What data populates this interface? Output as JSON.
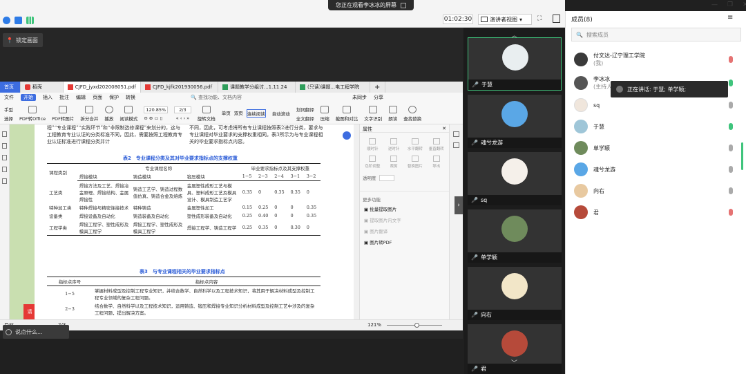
{
  "banner": {
    "text": "您正在观看李冰冰的屏幕"
  },
  "toolbar": {
    "timer": "01:02:30",
    "presenter_view": "演讲者视图"
  },
  "stage": {
    "lock_label": "锁定画面",
    "say_placeholder": "说点什么..."
  },
  "wps": {
    "tabs": [
      {
        "label": "首页"
      },
      {
        "label": "稻壳"
      },
      {
        "label": "CJFD_jyxd202008051.pdf"
      },
      {
        "label": "CJFD_kjfk201930056.pdf"
      },
      {
        "label": "课题教学分组讨...1.11.24"
      },
      {
        "label": "(只读)课题...电工程学院"
      }
    ],
    "menus": [
      "文件",
      "开始",
      "插入",
      "批注",
      "编辑",
      "页面",
      "保护",
      "转换"
    ],
    "active_menu": "开始",
    "tools": [
      "手型",
      "选择",
      "PDF转Office",
      "PDF转图片",
      "拆分合并",
      "播放",
      "阅读模式",
      "旋转文档",
      "单页",
      "双页",
      "连续阅读",
      "自动滚动",
      "划词翻译",
      "全文翻译",
      "压缩",
      "截图和对比",
      "文字识别",
      "朗读",
      "查找替换"
    ],
    "zoom": "120.85%",
    "page_indicator": "2/3",
    "search_placeholder": "查找功能、文档内容",
    "cloud": "未同步",
    "share": "分享",
    "doc": {
      "para1": "程”“专业课程”“实践环节”和“非限制选修课程”来划分的，这与工程教育专业认证的分类标准不同，因此，需要按照工程教育专业认证标准进行课程分类并计",
      "para2": "不同，因此，可考虑将所有专业课程按照表2进行分类，要求与专业课程对毕业要求的支撑权重相同。表3所示为与专业课程相关的毕业要求指标点内容。",
      "table2_caption": "表2　专业课程分类及其对毕业要求指标点的支撑权重",
      "table2_header": [
        "课程类别",
        "专业课程名称",
        "毕业要求指标点及其支撑权重"
      ],
      "table2_sub": [
        "焊接模块",
        "铸造模块",
        "锻压模块",
        "1−5",
        "2−3",
        "2−4",
        "3−1",
        "3−2"
      ],
      "table2_rows": [
        {
          "cat": "工艺类",
          "c1": "焊接方法及工艺、焊接冶金原理、焊接结构、金属焊接性",
          "c2": "铸造工艺学、铸造过程数值仿真、铸造合金及熔炼",
          "c3": "金属塑性成形工艺与模具、塑料成形工艺及模具设计、模具制造工艺学",
          "v": [
            "0.35",
            "0",
            "0.35",
            "0.35",
            "0"
          ]
        },
        {
          "cat": "特种加工类",
          "c1": "特种焊接与精密连接技术",
          "c2": "特种铸造",
          "c3": "金属塑性加工",
          "v": [
            "0.15",
            "0.25",
            "0",
            "0",
            "0.35"
          ]
        },
        {
          "cat": "设备类",
          "c1": "焊接设备及自动化",
          "c2": "铸造装备及自动化",
          "c3": "塑性成形装备及自动化",
          "v": [
            "0.25",
            "0.40",
            "0",
            "0",
            "0.35"
          ]
        },
        {
          "cat": "工程学类",
          "c1": "焊接工程学、塑性成形及模具工程学",
          "c2": "焊接工程学、塑性成形及模具工程学",
          "c3": "焊接工程学、铸造工程学",
          "v": [
            "0.25",
            "0.35",
            "0",
            "0.30",
            "0"
          ]
        }
      ],
      "table3_caption": "表3　与专业课程相关的毕业要求指标点",
      "table3_header": [
        "指标点序号",
        "指标点内容"
      ],
      "table3_rows": [
        {
          "id": "1−5",
          "text": "掌握材料成型及控制工程专业知识，并结合数学、自然科学以及工程技术知识，将其用于解决材料成型及控制工程专业领域的复杂工程问题。"
        },
        {
          "id": "2−3",
          "text": "结合数学、自然科学以及工程技术知识，运用铸造、锻压和焊接专业知识分析材料成型及控制工艺中涉及的复杂工程问题，提出解决方案。"
        }
      ]
    },
    "properties": {
      "title": "属性",
      "tools": [
        "顺时针",
        "逆时针",
        "水平翻转",
        "垂直翻转",
        "色阶调整",
        "裁剪",
        "替换图片",
        "导出"
      ],
      "opacity_label": "透明度",
      "more_label": "更多功能",
      "more_items": [
        "批量提取图片",
        "提取图片内文字",
        "图片翻译",
        "图片转PDF"
      ]
    },
    "status": {
      "nav": "导航",
      "page": "2/3",
      "zoom": "121%"
    }
  },
  "videos": [
    {
      "name": "于慧",
      "color": "#e9eef0",
      "selected": true
    },
    {
      "name": "魂兮龙游",
      "color": "#5aa7e6",
      "selected": false
    },
    {
      "name": "sq",
      "color": "#f5f0ea",
      "selected": false
    },
    {
      "name": "单学颖",
      "color": "#6f8b5c",
      "selected": false
    },
    {
      "name": "向右",
      "color": "#f2e6c8",
      "selected": false
    },
    {
      "name": "君",
      "color": "#b64a3a",
      "selected": false
    }
  ],
  "members": {
    "title": "成员(8)",
    "search_placeholder": "搜索成员",
    "speaking_tip": "正在讲话: 于慧; 单学颖;",
    "list": [
      {
        "name": "付文达-辽宁理工学院",
        "sub": "(我)",
        "color": "#3a3a3a",
        "mic": "off"
      },
      {
        "name": "李冰冰",
        "sub": "(主持人",
        "color": "#555555",
        "mic": "on"
      },
      {
        "name": "sq",
        "sub": "",
        "color": "#f0e6dc",
        "mic": "idle"
      },
      {
        "name": "于慧",
        "sub": "",
        "color": "#9fc6d8",
        "mic": "on"
      },
      {
        "name": "单学颖",
        "sub": "",
        "color": "#6f8b5c",
        "mic": "idle"
      },
      {
        "name": "魂兮龙游",
        "sub": "",
        "color": "#5aa7e6",
        "mic": "idle"
      },
      {
        "name": "向右",
        "sub": "",
        "color": "#e8c9a0",
        "mic": "idle"
      },
      {
        "name": "君",
        "sub": "",
        "color": "#b64a3a",
        "mic": "off"
      }
    ]
  }
}
